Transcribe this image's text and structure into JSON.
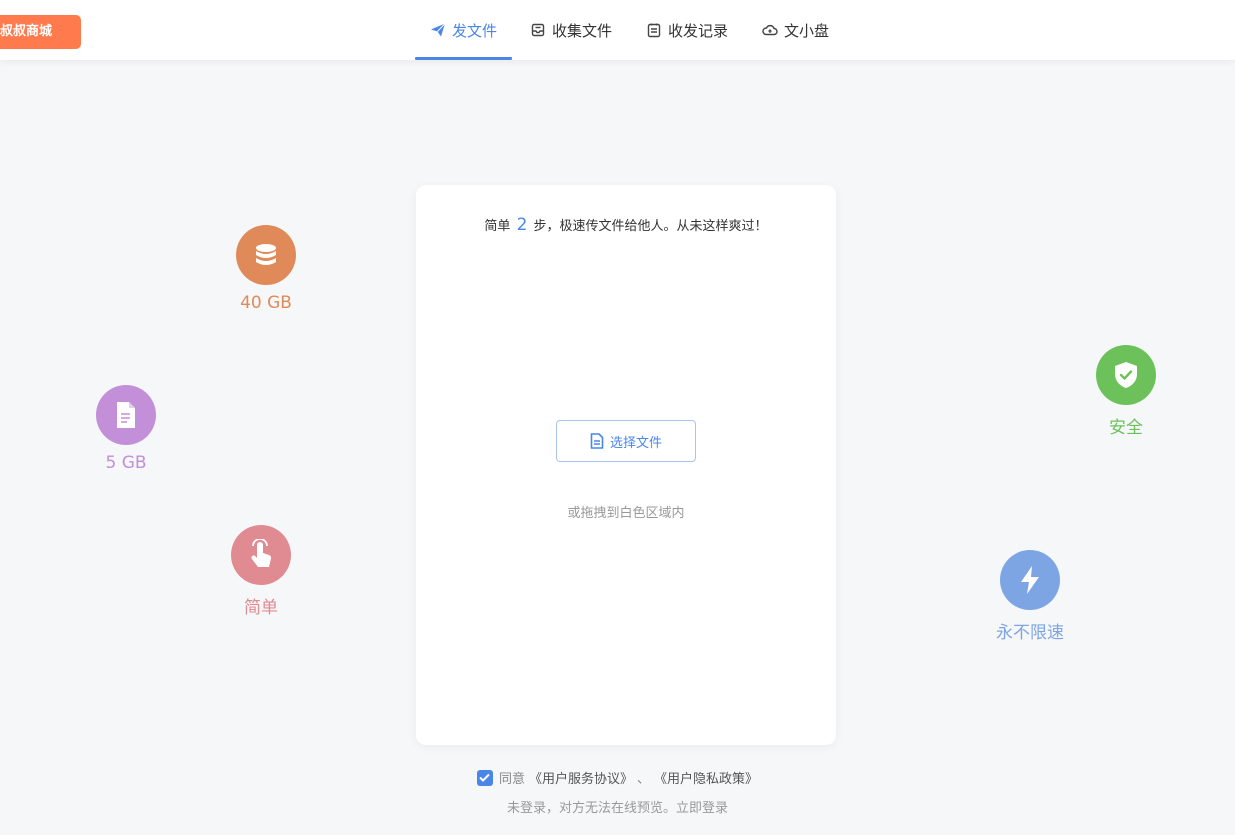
{
  "header": {
    "shop_button": "叔叔商城",
    "tabs": [
      {
        "label": "发文件",
        "icon": "paper-plane-icon",
        "active": true
      },
      {
        "label": "收集文件",
        "icon": "inbox-tray-icon",
        "active": false
      },
      {
        "label": "收发记录",
        "icon": "clipboard-icon",
        "active": false
      },
      {
        "label": "文小盘",
        "icon": "cloud-icon",
        "active": false
      }
    ]
  },
  "features": [
    {
      "label": "40 GB",
      "icon": "database-icon",
      "color": "#e08a5a"
    },
    {
      "label": "5 GB",
      "icon": "document-icon",
      "color": "#c28fd8"
    },
    {
      "label": "简单",
      "icon": "tap-hand-icon",
      "color": "#e08a92"
    },
    {
      "label": "安全",
      "icon": "shield-check-icon",
      "color": "#6cc15b"
    },
    {
      "label": "永不限速",
      "icon": "lightning-icon",
      "color": "#7ea5e3"
    }
  ],
  "card": {
    "intro_prefix": "简单",
    "intro_step": "2",
    "intro_suffix": "步，极速传文件给他人。从未这样爽过！",
    "select_button": "选择文件",
    "drag_hint": "或拖拽到白色区域内"
  },
  "footer": {
    "agree_checked": true,
    "agree_text": "同意",
    "terms_link": "《用户服务协议》",
    "separator": "、",
    "privacy_link": "《用户隐私政策》",
    "login_note": "未登录，对方无法在线预览。",
    "login_link": "立即登录"
  },
  "colors": {
    "accent": "#4a86e8",
    "shop": "#ff7a4d",
    "background": "#f6f7f9"
  }
}
